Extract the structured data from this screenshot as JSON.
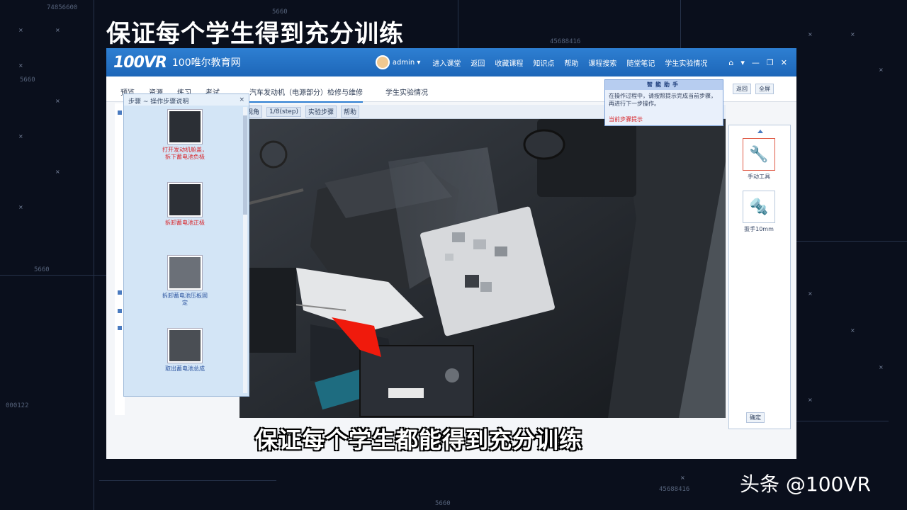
{
  "caption_top": "保证每个学生得到充分训练",
  "subtitle": "保证每个学生都能得到充分训练",
  "watermark": "头条 @100VR",
  "bg_labels": [
    "74856600",
    "5660",
    "45688416",
    "5660",
    "5660",
    "000122",
    "5660",
    "45688416"
  ],
  "app": {
    "logo": "100VR",
    "title": "100唯尔教育网",
    "user": "admin",
    "nav": [
      "进入课堂",
      "返回",
      "收藏课程",
      "知识点",
      "帮助",
      "课程搜索",
      "随堂笔记",
      "学生实验情况"
    ],
    "window_controls": [
      "⌂",
      "▾",
      "—",
      "❐",
      "✕"
    ],
    "left_tabs": [
      "预览",
      "资源",
      "练习",
      "考试"
    ],
    "tabs": [
      "汽车发动机（电源部分）检修与维修",
      "学生实验情况"
    ],
    "toolbar": [
      "视角",
      "1/8(step)",
      "实验步骤",
      "帮助"
    ],
    "thumb_panel": {
      "title": "步骤 ~ 操作步骤说明",
      "close": "×",
      "items": [
        {
          "caption": "打开发动机舱盖，拆下蓄电池负极",
          "color": "red"
        },
        {
          "caption": "拆卸蓄电池正极",
          "color": "red"
        },
        {
          "caption": "拆卸蓄电池压板固定",
          "color": "blue"
        },
        {
          "caption": "取出蓄电池总成",
          "color": "blue"
        }
      ]
    },
    "tip": {
      "head": "智能助手",
      "body": "在操作过程中，请按照提示完成当前步骤，再进行下一步操作。",
      "foot": "当前步骤提示"
    },
    "small_buttons": [
      "返回",
      "全屏"
    ],
    "tools": [
      {
        "icon": "wrench-icon",
        "label": "手动工具"
      },
      {
        "icon": "spanner-icon",
        "label": "扳手10mm"
      }
    ],
    "confirm": "确定"
  }
}
